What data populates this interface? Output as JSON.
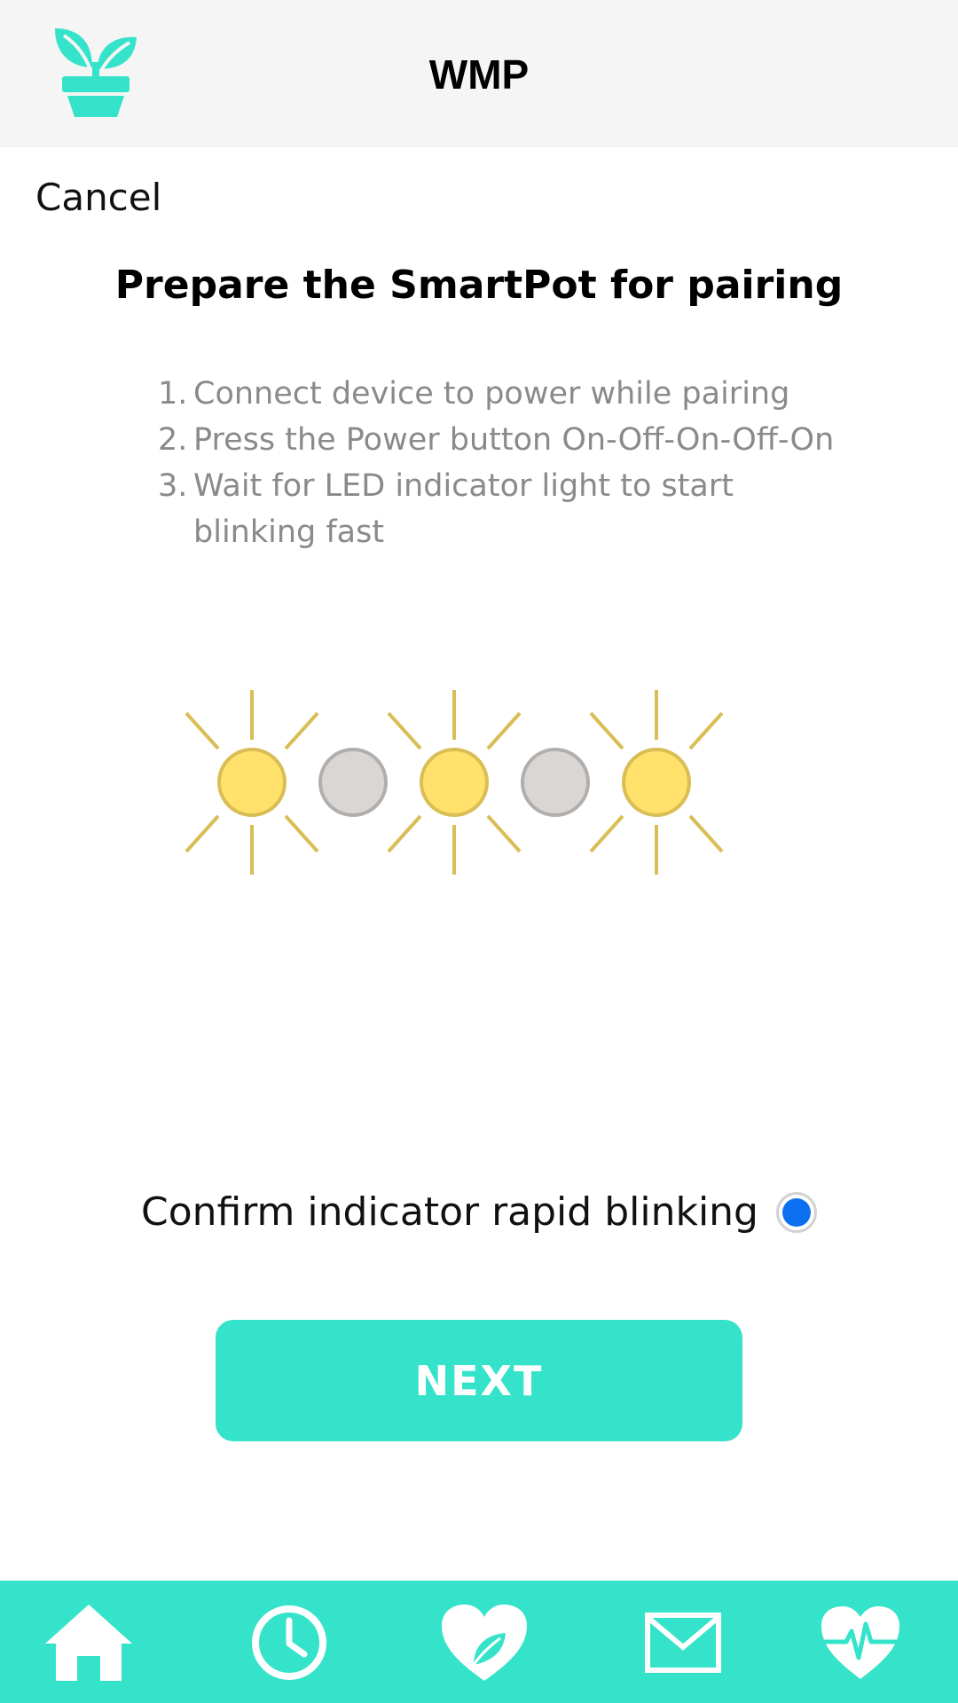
{
  "header": {
    "title": "WMP",
    "logo_icon": "plant-pot-icon"
  },
  "cancel_label": "Cancel",
  "heading": "Prepare the SmartPot for pairing",
  "steps": [
    {
      "num": "1.",
      "text": "Connect device to power while pairing"
    },
    {
      "num": "2.",
      "text": "Press the Power button On-Off-On-Off-On"
    },
    {
      "num": "3.",
      "text": "Wait for LED indicator light to start blinking fast"
    }
  ],
  "led_pattern": [
    "on",
    "off",
    "on",
    "off",
    "on"
  ],
  "confirm": {
    "label": "Confirm indicator rapid blinking",
    "selected": true
  },
  "next_label": "NEXT",
  "nav": [
    {
      "name": "home-icon"
    },
    {
      "name": "clock-icon"
    },
    {
      "name": "heart-leaf-icon"
    },
    {
      "name": "mail-icon"
    },
    {
      "name": "heartbeat-icon"
    }
  ],
  "colors": {
    "accent": "#34e3c9",
    "led_on_fill": "#ffe16b",
    "led_on_stroke": "#d9bd55",
    "led_off_fill": "#d9d6d4",
    "led_off_stroke": "#b1afae",
    "radio_selected": "#0b6ff0",
    "header_bg": "#f5f5f5"
  }
}
